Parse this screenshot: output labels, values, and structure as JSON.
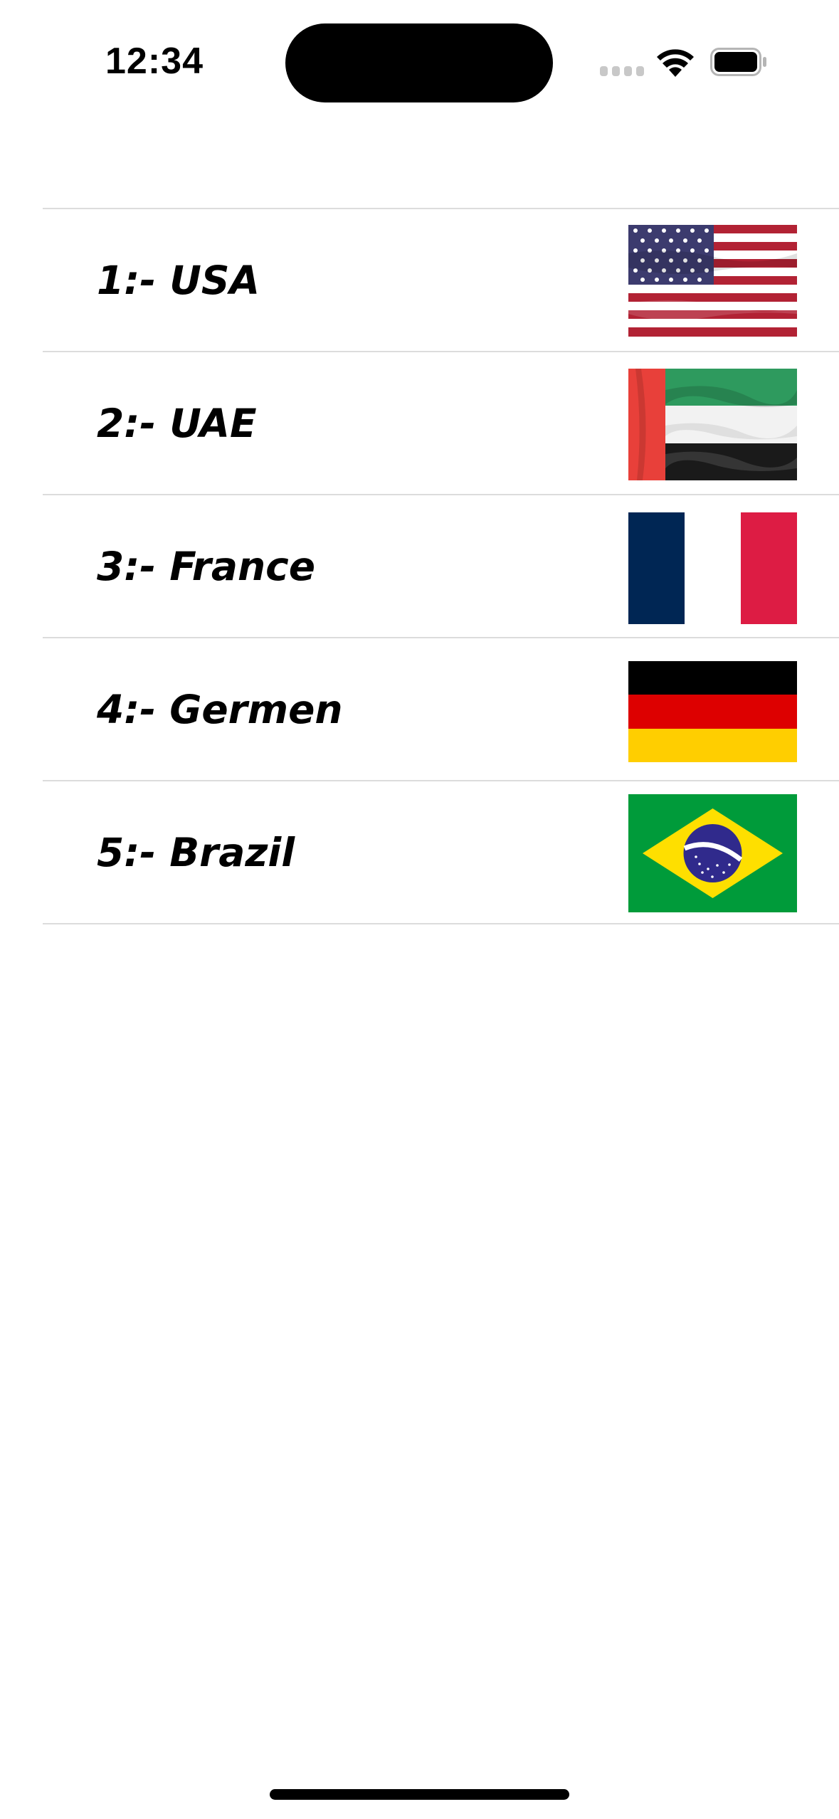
{
  "status_bar": {
    "time": "12:34",
    "icons": [
      "signal-icon",
      "wifi-icon",
      "battery-icon"
    ]
  },
  "countries": [
    {
      "label": "1:- USA",
      "flag": "usa-flag-icon"
    },
    {
      "label": "2:- UAE",
      "flag": "uae-flag-icon"
    },
    {
      "label": "3:- France",
      "flag": "france-flag-icon"
    },
    {
      "label": "4:- Germen",
      "flag": "germany-flag-icon"
    },
    {
      "label": "5:- Brazil",
      "flag": "brazil-flag-icon"
    }
  ],
  "colors": {
    "usa_red": "#b22234",
    "usa_blue": "#3c3b6e",
    "uae_red": "#e8403a",
    "uae_green": "#2e9a5e",
    "france_blue": "#002654",
    "france_red": "#dd1c44",
    "germany_black": "#000000",
    "germany_red": "#dd0000",
    "germany_gold": "#ffce00",
    "brazil_green": "#009b3a",
    "brazil_yellow": "#fedf00",
    "brazil_blue": "#302a8c",
    "separator": "#dcdcdc"
  }
}
